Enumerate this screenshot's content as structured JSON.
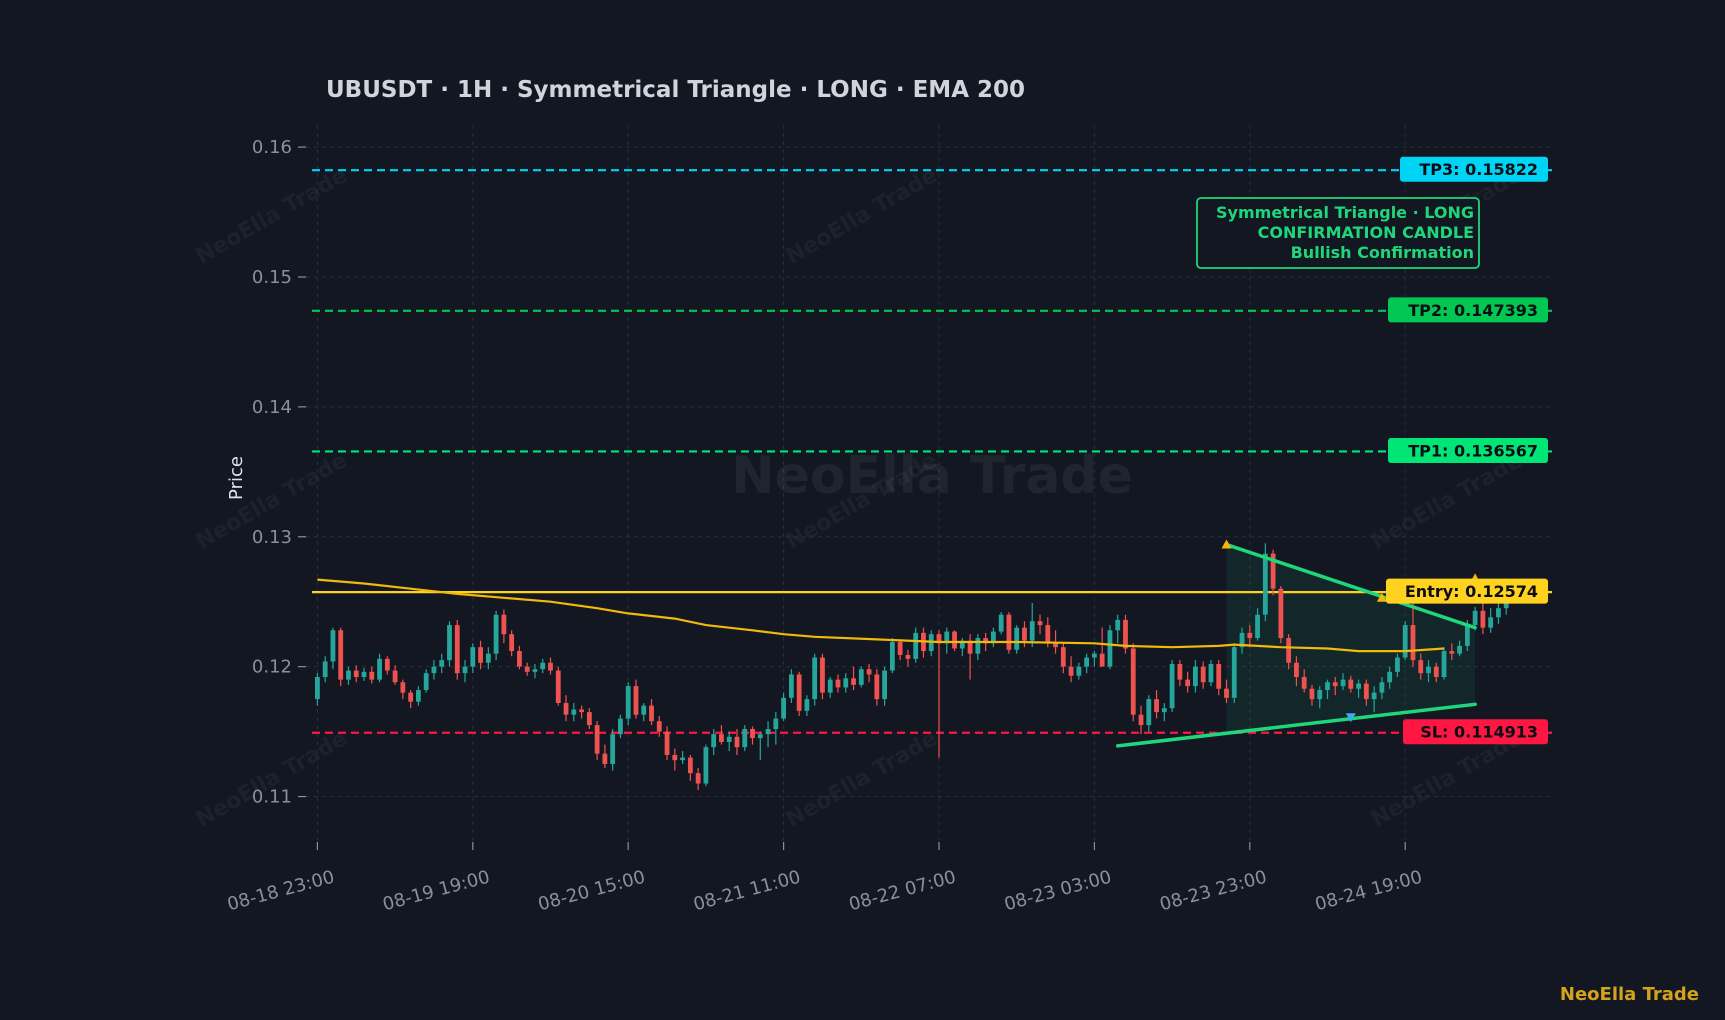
{
  "title": "UBUSDT  ·  1H  ·  Symmetrical Triangle  ·  LONG  ·  EMA 200",
  "brand": "NeoElla Trade",
  "watermark": "NeoElla Trade",
  "colors": {
    "background": "#131722",
    "grid": "#2a2e39",
    "up": "#26a69a",
    "down": "#ef5350",
    "ema": "#f0b90b",
    "entry": "#ffd21f",
    "tp1": "#00e676",
    "tp2": "#00c853",
    "tp3": "#00d4f5",
    "sl": "#ff1744",
    "triangle": "#1fd67a",
    "brand": "#d4a21c"
  },
  "chart_data": {
    "type": "candlestick",
    "symbol": "UBUSDT",
    "timeframe": "1H",
    "ylabel": "Price",
    "xlabel": "",
    "ylim": [
      0.1065,
      0.1617
    ],
    "yticks": [
      0.11,
      0.12,
      0.13,
      0.14,
      0.15,
      0.16
    ],
    "xticks": [
      "08-18 23:00",
      "08-19 19:00",
      "08-20 15:00",
      "08-21 11:00",
      "08-22 07:00",
      "08-23 03:00",
      "08-23 23:00",
      "08-24 19:00"
    ],
    "xtick_bar_index": [
      0,
      20,
      40,
      60,
      80,
      100,
      120,
      140
    ],
    "grid": true,
    "candles_ohlc": [
      [
        0.1175,
        0.1195,
        0.117,
        0.1192
      ],
      [
        0.1192,
        0.1208,
        0.1188,
        0.1204
      ],
      [
        0.1204,
        0.123,
        0.1198,
        0.1228
      ],
      [
        0.1228,
        0.123,
        0.1185,
        0.119
      ],
      [
        0.119,
        0.12,
        0.1186,
        0.1197
      ],
      [
        0.1197,
        0.1201,
        0.1188,
        0.1192
      ],
      [
        0.1192,
        0.1199,
        0.1189,
        0.1196
      ],
      [
        0.1196,
        0.12,
        0.1187,
        0.119
      ],
      [
        0.119,
        0.121,
        0.1188,
        0.1206
      ],
      [
        0.1206,
        0.1208,
        0.1194,
        0.1197
      ],
      [
        0.1197,
        0.1201,
        0.1186,
        0.1188
      ],
      [
        0.1188,
        0.119,
        0.1175,
        0.118
      ],
      [
        0.118,
        0.1182,
        0.1168,
        0.1173
      ],
      [
        0.1173,
        0.1185,
        0.117,
        0.1182
      ],
      [
        0.1182,
        0.1198,
        0.118,
        0.1195
      ],
      [
        0.1195,
        0.1205,
        0.119,
        0.12
      ],
      [
        0.12,
        0.121,
        0.1195,
        0.1205
      ],
      [
        0.1205,
        0.1235,
        0.12,
        0.1232
      ],
      [
        0.1232,
        0.1236,
        0.119,
        0.1195
      ],
      [
        0.1195,
        0.1205,
        0.1188,
        0.12
      ],
      [
        0.12,
        0.1218,
        0.1195,
        0.1215
      ],
      [
        0.1215,
        0.122,
        0.1198,
        0.1203
      ],
      [
        0.1203,
        0.1215,
        0.1198,
        0.121
      ],
      [
        0.121,
        0.1243,
        0.1205,
        0.124
      ],
      [
        0.124,
        0.1244,
        0.1218,
        0.1225
      ],
      [
        0.1225,
        0.1228,
        0.1208,
        0.1212
      ],
      [
        0.1212,
        0.1216,
        0.1198,
        0.12
      ],
      [
        0.12,
        0.1203,
        0.1193,
        0.1196
      ],
      [
        0.1196,
        0.1202,
        0.1191,
        0.1198
      ],
      [
        0.1198,
        0.1206,
        0.1195,
        0.1203
      ],
      [
        0.1203,
        0.1207,
        0.1194,
        0.1197
      ],
      [
        0.1197,
        0.12,
        0.117,
        0.1172
      ],
      [
        0.1172,
        0.1178,
        0.1158,
        0.1163
      ],
      [
        0.1163,
        0.1172,
        0.1158,
        0.1167
      ],
      [
        0.1167,
        0.117,
        0.116,
        0.1165
      ],
      [
        0.1165,
        0.1168,
        0.1152,
        0.1155
      ],
      [
        0.1155,
        0.1158,
        0.1128,
        0.1133
      ],
      [
        0.1133,
        0.114,
        0.1122,
        0.1125
      ],
      [
        0.1125,
        0.1152,
        0.112,
        0.1148
      ],
      [
        0.1148,
        0.1163,
        0.1145,
        0.116
      ],
      [
        0.116,
        0.1188,
        0.1155,
        0.1185
      ],
      [
        0.1185,
        0.119,
        0.116,
        0.1163
      ],
      [
        0.1163,
        0.1172,
        0.1158,
        0.117
      ],
      [
        0.117,
        0.1175,
        0.1155,
        0.1158
      ],
      [
        0.1158,
        0.1162,
        0.1146,
        0.115
      ],
      [
        0.115,
        0.1154,
        0.1128,
        0.1132
      ],
      [
        0.1132,
        0.1137,
        0.112,
        0.1128
      ],
      [
        0.1128,
        0.1135,
        0.1125,
        0.113
      ],
      [
        0.113,
        0.1132,
        0.1112,
        0.1118
      ],
      [
        0.1118,
        0.1122,
        0.1105,
        0.111
      ],
      [
        0.111,
        0.114,
        0.1108,
        0.1138
      ],
      [
        0.1138,
        0.1152,
        0.1132,
        0.1148
      ],
      [
        0.1148,
        0.1155,
        0.114,
        0.1142
      ],
      [
        0.1142,
        0.115,
        0.1135,
        0.1146
      ],
      [
        0.1146,
        0.1152,
        0.1132,
        0.1138
      ],
      [
        0.1138,
        0.1155,
        0.1135,
        0.1152
      ],
      [
        0.1152,
        0.1154,
        0.114,
        0.1145
      ],
      [
        0.1145,
        0.115,
        0.1128,
        0.1148
      ],
      [
        0.1148,
        0.1158,
        0.1138,
        0.1152
      ],
      [
        0.1152,
        0.1165,
        0.114,
        0.116
      ],
      [
        0.116,
        0.118,
        0.1158,
        0.1176
      ],
      [
        0.1176,
        0.1198,
        0.1172,
        0.1194
      ],
      [
        0.1194,
        0.1196,
        0.1162,
        0.1166
      ],
      [
        0.1166,
        0.1178,
        0.1162,
        0.1175
      ],
      [
        0.1175,
        0.121,
        0.117,
        0.1207
      ],
      [
        0.1207,
        0.121,
        0.1175,
        0.118
      ],
      [
        0.118,
        0.1192,
        0.1176,
        0.119
      ],
      [
        0.119,
        0.1194,
        0.118,
        0.1184
      ],
      [
        0.1184,
        0.1195,
        0.118,
        0.1191
      ],
      [
        0.1191,
        0.12,
        0.1182,
        0.1186
      ],
      [
        0.1186,
        0.12,
        0.1184,
        0.1198
      ],
      [
        0.1198,
        0.1202,
        0.1188,
        0.1194
      ],
      [
        0.1194,
        0.1198,
        0.117,
        0.1175
      ],
      [
        0.1175,
        0.12,
        0.117,
        0.1197
      ],
      [
        0.1197,
        0.1222,
        0.1195,
        0.1219
      ],
      [
        0.1219,
        0.1221,
        0.1205,
        0.1209
      ],
      [
        0.1209,
        0.1213,
        0.12,
        0.1206
      ],
      [
        0.1206,
        0.123,
        0.1203,
        0.1226
      ],
      [
        0.1226,
        0.123,
        0.1207,
        0.1212
      ],
      [
        0.1212,
        0.1228,
        0.1208,
        0.1225
      ],
      [
        0.1225,
        0.1228,
        0.113,
        0.1218
      ],
      [
        0.1218,
        0.123,
        0.121,
        0.1227
      ],
      [
        0.1227,
        0.1228,
        0.1212,
        0.1214
      ],
      [
        0.1214,
        0.1222,
        0.1208,
        0.122
      ],
      [
        0.122,
        0.1225,
        0.119,
        0.121
      ],
      [
        0.121,
        0.1225,
        0.1205,
        0.1222
      ],
      [
        0.1222,
        0.1226,
        0.1212,
        0.1218
      ],
      [
        0.1218,
        0.123,
        0.1215,
        0.1227
      ],
      [
        0.1227,
        0.1242,
        0.1225,
        0.124
      ],
      [
        0.124,
        0.1242,
        0.121,
        0.1213
      ],
      [
        0.1213,
        0.1232,
        0.121,
        0.123
      ],
      [
        0.123,
        0.1235,
        0.1215,
        0.122
      ],
      [
        0.122,
        0.1249,
        0.1215,
        0.1235
      ],
      [
        0.1235,
        0.124,
        0.1225,
        0.1232
      ],
      [
        0.1232,
        0.1238,
        0.1215,
        0.1218
      ],
      [
        0.1218,
        0.1228,
        0.121,
        0.1215
      ],
      [
        0.1215,
        0.1218,
        0.1195,
        0.12
      ],
      [
        0.12,
        0.1208,
        0.1188,
        0.1193
      ],
      [
        0.1193,
        0.1203,
        0.119,
        0.12
      ],
      [
        0.12,
        0.121,
        0.1195,
        0.1207
      ],
      [
        0.1207,
        0.1212,
        0.12,
        0.121
      ],
      [
        0.121,
        0.123,
        0.1205,
        0.12
      ],
      [
        0.12,
        0.1232,
        0.1198,
        0.1228
      ],
      [
        0.1228,
        0.124,
        0.1218,
        0.1236
      ],
      [
        0.1236,
        0.124,
        0.121,
        0.1214
      ],
      [
        0.1214,
        0.1218,
        0.1158,
        0.1163
      ],
      [
        0.1163,
        0.117,
        0.1148,
        0.1155
      ],
      [
        0.1155,
        0.1178,
        0.115,
        0.1175
      ],
      [
        0.1175,
        0.1182,
        0.116,
        0.1165
      ],
      [
        0.1165,
        0.1172,
        0.1158,
        0.1168
      ],
      [
        0.1168,
        0.1205,
        0.1165,
        0.1202
      ],
      [
        0.1202,
        0.1205,
        0.1185,
        0.119
      ],
      [
        0.119,
        0.1196,
        0.118,
        0.1185
      ],
      [
        0.1185,
        0.1205,
        0.118,
        0.12
      ],
      [
        0.12,
        0.1204,
        0.1183,
        0.1188
      ],
      [
        0.1188,
        0.1205,
        0.1185,
        0.1202
      ],
      [
        0.1202,
        0.1205,
        0.1178,
        0.1183
      ],
      [
        0.1183,
        0.119,
        0.1172,
        0.1176
      ],
      [
        0.1176,
        0.1218,
        0.1172,
        0.1215
      ],
      [
        0.1215,
        0.123,
        0.121,
        0.1226
      ],
      [
        0.1226,
        0.1232,
        0.1215,
        0.1222
      ],
      [
        0.1222,
        0.1245,
        0.122,
        0.124
      ],
      [
        0.124,
        0.1295,
        0.1235,
        0.1287
      ],
      [
        0.1287,
        0.129,
        0.1255,
        0.126
      ],
      [
        0.126,
        0.1262,
        0.1218,
        0.1222
      ],
      [
        0.1222,
        0.1225,
        0.1198,
        0.1203
      ],
      [
        0.1203,
        0.1208,
        0.1185,
        0.1192
      ],
      [
        0.1192,
        0.1198,
        0.118,
        0.1183
      ],
      [
        0.1183,
        0.1186,
        0.117,
        0.1175
      ],
      [
        0.1175,
        0.1185,
        0.1168,
        0.1182
      ],
      [
        0.1182,
        0.119,
        0.1175,
        0.1188
      ],
      [
        0.1188,
        0.1192,
        0.1178,
        0.1185
      ],
      [
        0.1185,
        0.1195,
        0.1182,
        0.119
      ],
      [
        0.119,
        0.1193,
        0.118,
        0.1183
      ],
      [
        0.1183,
        0.119,
        0.1176,
        0.1187
      ],
      [
        0.1187,
        0.119,
        0.117,
        0.1175
      ],
      [
        0.1175,
        0.1185,
        0.1165,
        0.118
      ],
      [
        0.118,
        0.1192,
        0.1175,
        0.1188
      ],
      [
        0.1188,
        0.12,
        0.1183,
        0.1196
      ],
      [
        0.1196,
        0.121,
        0.1192,
        0.1207
      ],
      [
        0.1207,
        0.1235,
        0.1205,
        0.1232
      ],
      [
        0.1232,
        0.1252,
        0.12,
        0.1205
      ],
      [
        0.1205,
        0.121,
        0.119,
        0.1195
      ],
      [
        0.1195,
        0.1205,
        0.1188,
        0.12
      ],
      [
        0.12,
        0.1203,
        0.1188,
        0.1192
      ],
      [
        0.1192,
        0.1215,
        0.119,
        0.1212
      ],
      [
        0.1212,
        0.1218,
        0.1205,
        0.121
      ],
      [
        0.121,
        0.122,
        0.1208,
        0.1216
      ],
      [
        0.1216,
        0.1236,
        0.1212,
        0.1232
      ],
      [
        0.1232,
        0.1246,
        0.1228,
        0.1243
      ],
      [
        0.1243,
        0.125,
        0.1225,
        0.123
      ],
      [
        0.123,
        0.1245,
        0.1226,
        0.1238
      ],
      [
        0.1238,
        0.125,
        0.1233,
        0.1245
      ],
      [
        0.1245,
        0.1268,
        0.124,
        0.1252
      ]
    ],
    "ema200": [
      [
        0,
        0.1267
      ],
      [
        6,
        0.1264
      ],
      [
        12,
        0.126
      ],
      [
        18,
        0.1256
      ],
      [
        24,
        0.1253
      ],
      [
        30,
        0.125
      ],
      [
        36,
        0.1245
      ],
      [
        40,
        0.1241
      ],
      [
        46,
        0.1237
      ],
      [
        50,
        0.1232
      ],
      [
        56,
        0.1228
      ],
      [
        60,
        0.1225
      ],
      [
        64,
        0.1223
      ],
      [
        72,
        0.1221
      ],
      [
        80,
        0.1219
      ],
      [
        90,
        0.1219
      ],
      [
        100,
        0.1218
      ],
      [
        104,
        0.1216
      ],
      [
        110,
        0.1215
      ],
      [
        116,
        0.1216
      ],
      [
        118,
        0.1217
      ],
      [
        124,
        0.1215
      ],
      [
        130,
        0.1214
      ],
      [
        134,
        0.1212
      ],
      [
        140,
        0.1212
      ],
      [
        145,
        0.1214
      ]
    ],
    "levels": [
      {
        "name": "tp3",
        "label": "TP3: 0.15822",
        "value": 0.15822
      },
      {
        "name": "tp2",
        "label": "TP2: 0.147393",
        "value": 0.147393
      },
      {
        "name": "tp1",
        "label": "TP1: 0.136567",
        "value": 0.136567
      },
      {
        "name": "entry",
        "label": "Entry: 0.12574",
        "value": 0.12574
      },
      {
        "name": "sl",
        "label": "SL: 0.114913",
        "value": 0.114913
      }
    ],
    "triangle": {
      "upper": [
        [
          117,
          0.1294
        ],
        [
          149,
          0.123
        ]
      ],
      "lower": [
        [
          103,
          0.1139
        ],
        [
          149,
          0.1171
        ]
      ],
      "shade_start": 117
    },
    "markers": [
      {
        "type": "high",
        "index": 117,
        "value": 0.1294
      },
      {
        "type": "high",
        "index": 137,
        "value": 0.1253
      },
      {
        "type": "low",
        "index": 133,
        "value": 0.1161
      },
      {
        "type": "high",
        "index": 149,
        "value": 0.1268
      }
    ],
    "annotation": [
      "Symmetrical Triangle · LONG",
      "CONFIRMATION CANDLE",
      "Bullish Confirmation"
    ]
  }
}
